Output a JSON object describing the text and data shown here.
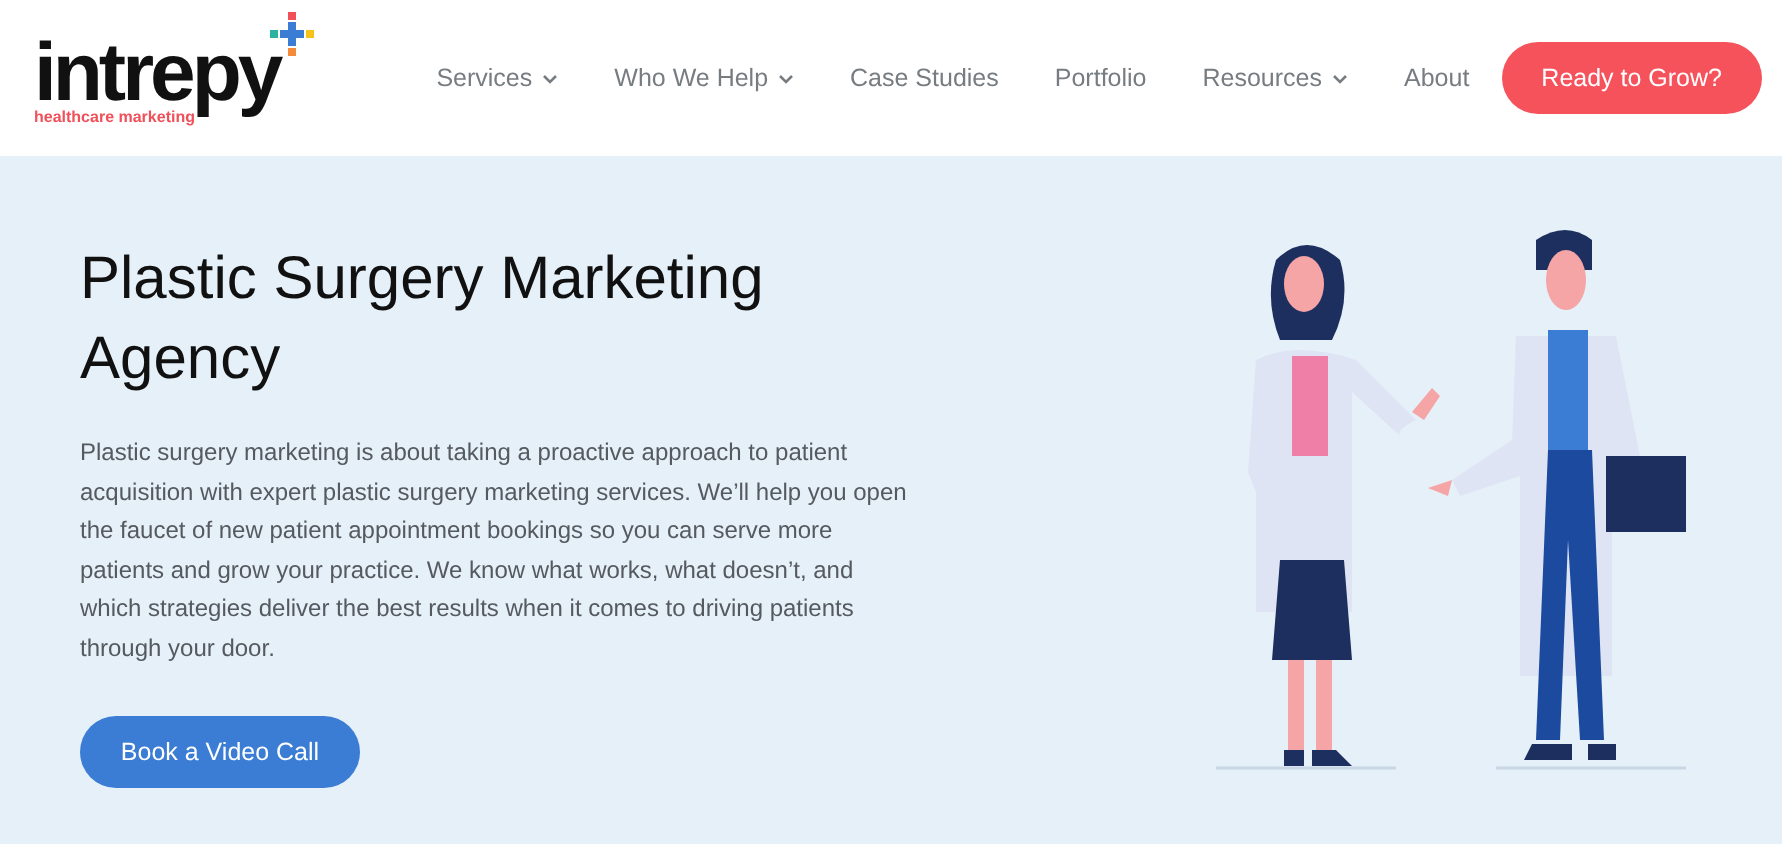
{
  "logo": {
    "name": "intrepy",
    "tagline": "healthcare marketing"
  },
  "nav": [
    {
      "label": "Services",
      "dropdown": true
    },
    {
      "label": "Who We Help",
      "dropdown": true
    },
    {
      "label": "Case Studies",
      "dropdown": false
    },
    {
      "label": "Portfolio",
      "dropdown": false
    },
    {
      "label": "Resources",
      "dropdown": true
    },
    {
      "label": "About",
      "dropdown": false
    }
  ],
  "cta": "Ready to Grow?",
  "hero": {
    "title": "Plastic Surgery Marketing Agency",
    "text": "Plastic surgery marketing is about taking a proactive approach to patient acquisition with expert plastic surgery marketing services. We’ll help you open the faucet of new patient appointment bookings so you can serve more patients and grow your practice. We know what works, what doesn’t, and which strategies deliver the best results when it comes to driving patients through your door.",
    "button": "Book a Video Call"
  }
}
